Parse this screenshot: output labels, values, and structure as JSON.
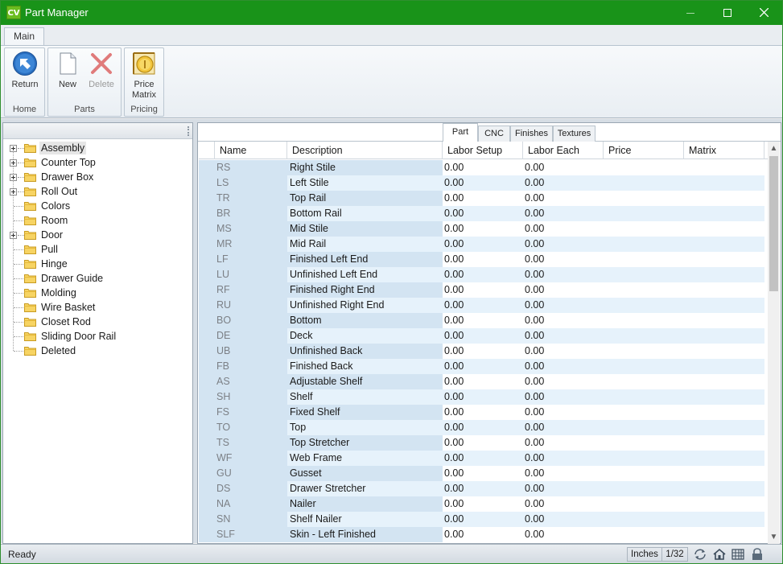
{
  "window": {
    "icon_text": "CV",
    "title": "Part Manager"
  },
  "ribbon": {
    "tabs": [
      "Main"
    ],
    "groups": {
      "home": {
        "label": "Home",
        "return_label": "Return"
      },
      "parts": {
        "label": "Parts",
        "new_label": "New",
        "delete_label": "Delete"
      },
      "pricing": {
        "label": "Pricing",
        "price_line1": "Price",
        "price_line2": "Matrix"
      }
    }
  },
  "tree": {
    "items": [
      {
        "label": "Assembly",
        "expandable": true
      },
      {
        "label": "Counter Top",
        "expandable": true
      },
      {
        "label": "Drawer Box",
        "expandable": true
      },
      {
        "label": "Roll Out",
        "expandable": true
      },
      {
        "label": "Colors",
        "expandable": false
      },
      {
        "label": "Room",
        "expandable": false
      },
      {
        "label": "Door",
        "expandable": true
      },
      {
        "label": "Pull",
        "expandable": false
      },
      {
        "label": "Hinge",
        "expandable": false
      },
      {
        "label": "Drawer Guide",
        "expandable": false
      },
      {
        "label": "Molding",
        "expandable": false
      },
      {
        "label": "Wire Basket",
        "expandable": false
      },
      {
        "label": "Closet Rod",
        "expandable": false
      },
      {
        "label": "Sliding Door Rail",
        "expandable": false
      },
      {
        "label": "Deleted",
        "expandable": false
      }
    ]
  },
  "grid_tabs": [
    "Part",
    "CNC",
    "Finishes",
    "Textures"
  ],
  "grid": {
    "columns": [
      "Name",
      "Description",
      "Labor Setup",
      "Labor Each",
      "Price",
      "Matrix"
    ],
    "rows": [
      {
        "name": "RS",
        "desc": "Right Stile",
        "setup": "0.00",
        "each": "0.00"
      },
      {
        "name": "LS",
        "desc": "Left Stile",
        "setup": "0.00",
        "each": "0.00"
      },
      {
        "name": "TR",
        "desc": "Top Rail",
        "setup": "0.00",
        "each": "0.00"
      },
      {
        "name": "BR",
        "desc": "Bottom Rail",
        "setup": "0.00",
        "each": "0.00"
      },
      {
        "name": "MS",
        "desc": "Mid Stile",
        "setup": "0.00",
        "each": "0.00"
      },
      {
        "name": "MR",
        "desc": "Mid Rail",
        "setup": "0.00",
        "each": "0.00"
      },
      {
        "name": "LF",
        "desc": "Finished Left End",
        "setup": "0.00",
        "each": "0.00"
      },
      {
        "name": "LU",
        "desc": "Unfinished Left End",
        "setup": "0.00",
        "each": "0.00"
      },
      {
        "name": "RF",
        "desc": "Finished Right End",
        "setup": "0.00",
        "each": "0.00"
      },
      {
        "name": "RU",
        "desc": "Unfinished Right End",
        "setup": "0.00",
        "each": "0.00"
      },
      {
        "name": "BO",
        "desc": "Bottom",
        "setup": "0.00",
        "each": "0.00"
      },
      {
        "name": "DE",
        "desc": "Deck",
        "setup": "0.00",
        "each": "0.00"
      },
      {
        "name": "UB",
        "desc": "Unfinished Back",
        "setup": "0.00",
        "each": "0.00"
      },
      {
        "name": "FB",
        "desc": "Finished Back",
        "setup": "0.00",
        "each": "0.00"
      },
      {
        "name": "AS",
        "desc": "Adjustable Shelf",
        "setup": "0.00",
        "each": "0.00"
      },
      {
        "name": "SH",
        "desc": "Shelf",
        "setup": "0.00",
        "each": "0.00"
      },
      {
        "name": "FS",
        "desc": "Fixed Shelf",
        "setup": "0.00",
        "each": "0.00"
      },
      {
        "name": "TO",
        "desc": "Top",
        "setup": "0.00",
        "each": "0.00"
      },
      {
        "name": "TS",
        "desc": "Top Stretcher",
        "setup": "0.00",
        "each": "0.00"
      },
      {
        "name": "WF",
        "desc": "Web Frame",
        "setup": "0.00",
        "each": "0.00"
      },
      {
        "name": "GU",
        "desc": "Gusset",
        "setup": "0.00",
        "each": "0.00"
      },
      {
        "name": "DS",
        "desc": "Drawer Stretcher",
        "setup": "0.00",
        "each": "0.00"
      },
      {
        "name": "NA",
        "desc": "Nailer",
        "setup": "0.00",
        "each": "0.00"
      },
      {
        "name": "SN",
        "desc": "Shelf Nailer",
        "setup": "0.00",
        "each": "0.00"
      },
      {
        "name": "SLF",
        "desc": "Skin - Left Finished",
        "setup": "0.00",
        "each": "0.00"
      }
    ]
  },
  "status": {
    "text": "Ready",
    "units": "Inches",
    "fraction": "1/32"
  },
  "colors": {
    "titlebar": "#199319",
    "row_alt": "#e6f2fb",
    "name_col": "#d3e4f2"
  }
}
